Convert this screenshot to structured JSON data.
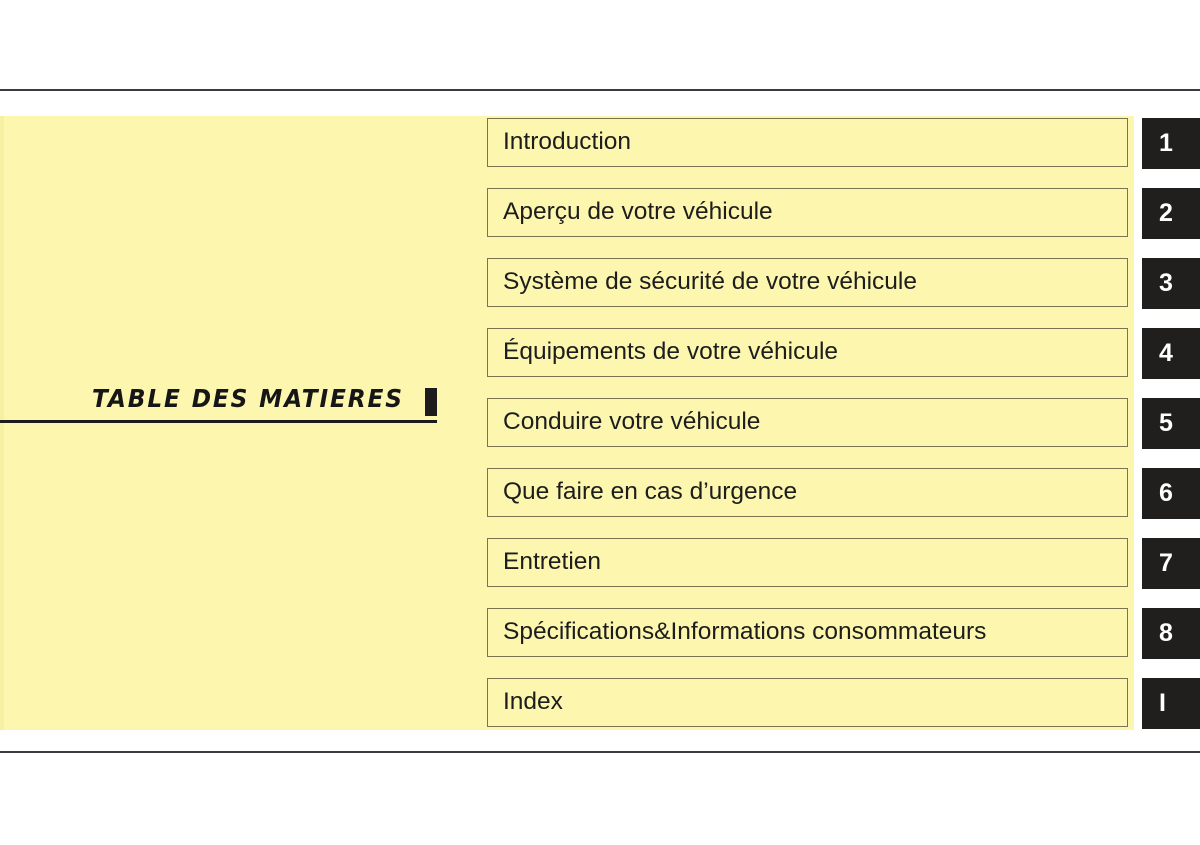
{
  "document": {
    "title_block": {
      "title": "TABLE  DES  MATIERES"
    },
    "colors": {
      "panel_background": "#fcf6ae",
      "row_border": "#7b7450",
      "tab_background": "#211f1d",
      "tab_text": "#ffffff",
      "body_text": "#1d1d1d",
      "rule": "#3b3b42"
    },
    "chapters": [
      {
        "label": "Introduction",
        "tab": "1"
      },
      {
        "label": "Aperçu de votre véhicule",
        "tab": "2"
      },
      {
        "label": "Système de sécurité de votre véhicule",
        "tab": "3"
      },
      {
        "label": "Équipements de votre véhicule",
        "tab": "4"
      },
      {
        "label": "Conduire votre véhicule",
        "tab": "5"
      },
      {
        "label": "Que faire en cas d’urgence",
        "tab": "6"
      },
      {
        "label": "Entretien",
        "tab": "7"
      },
      {
        "label": "Spécifications&Informations consommateurs",
        "tab": "8"
      },
      {
        "label": "Index",
        "tab": "I"
      }
    ]
  }
}
